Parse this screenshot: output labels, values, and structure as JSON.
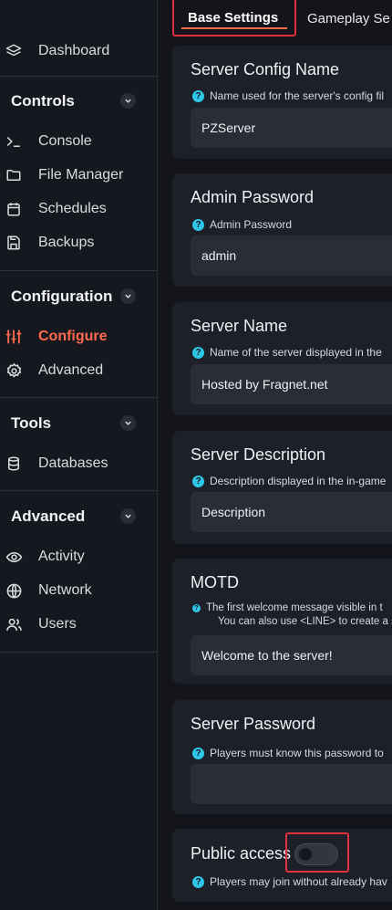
{
  "sidebar": {
    "top_items": [
      {
        "label": "Dashboard",
        "icon": "layers-icon"
      }
    ],
    "sections": [
      {
        "title": "Controls",
        "items": [
          {
            "label": "Console",
            "icon": "terminal-icon"
          },
          {
            "label": "File Manager",
            "icon": "folder-icon"
          },
          {
            "label": "Schedules",
            "icon": "calendar-icon"
          },
          {
            "label": "Backups",
            "icon": "save-icon"
          }
        ]
      },
      {
        "title": "Configuration",
        "items": [
          {
            "label": "Configure",
            "icon": "sliders-icon",
            "active": true
          },
          {
            "label": "Advanced",
            "icon": "gear-icon"
          }
        ]
      },
      {
        "title": "Tools",
        "items": [
          {
            "label": "Databases",
            "icon": "database-icon"
          }
        ]
      },
      {
        "title": "Advanced",
        "items": [
          {
            "label": "Activity",
            "icon": "eye-icon"
          },
          {
            "label": "Network",
            "icon": "globe-icon"
          },
          {
            "label": "Users",
            "icon": "users-icon"
          }
        ]
      }
    ]
  },
  "tabs": {
    "base": "Base Settings",
    "gameplay": "Gameplay Se"
  },
  "cards": [
    {
      "title": "Server Config Name",
      "help": "Name used for the server's config fil",
      "value": "PZServer"
    },
    {
      "title": "Admin Password",
      "help": "Admin Password",
      "value": "admin"
    },
    {
      "title": "Server Name",
      "help": "Name of the server displayed in the",
      "value": "Hosted by Fragnet.net"
    },
    {
      "title": "Server Description",
      "help": "Description displayed in the in-game",
      "value": "Description"
    },
    {
      "title": "MOTD",
      "help": "The first welcome message visible in t",
      "help2": "You can also use <LINE> to create a s",
      "value": "Welcome to the server!"
    },
    {
      "title": "Server Password",
      "help": "Players must know this password to",
      "value": ""
    },
    {
      "title": "Public access",
      "help": "Players may join without already hav",
      "toggle_on": false
    }
  ],
  "colors": {
    "accent": "#ff6a4d",
    "highlight_box": "#e0323e",
    "help_icon": "#2ec6e6"
  }
}
